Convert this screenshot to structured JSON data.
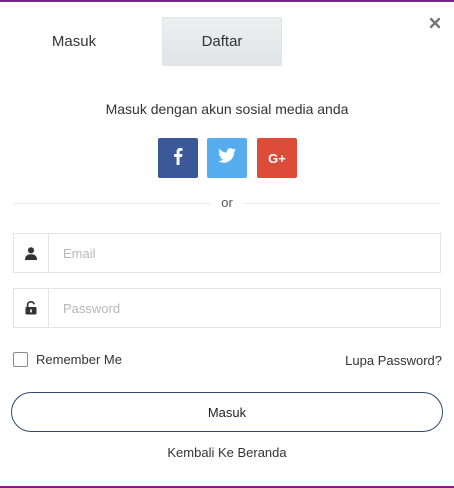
{
  "tabs": [
    {
      "label": "Masuk",
      "active": false
    },
    {
      "label": "Daftar",
      "active": true
    }
  ],
  "close_icon": "close-icon",
  "social": {
    "title": "Masuk dengan akun sosial media anda",
    "buttons": [
      {
        "name": "facebook",
        "icon": "facebook-icon",
        "color": "#3b5998"
      },
      {
        "name": "twitter",
        "icon": "twitter-icon",
        "color": "#55acee"
      },
      {
        "name": "google-plus",
        "label": "G+",
        "color": "#dd4b39"
      }
    ]
  },
  "divider_text": "or",
  "form": {
    "email": {
      "placeholder": "Email",
      "value": "",
      "icon": "user-icon"
    },
    "password": {
      "placeholder": "Password",
      "value": "",
      "icon": "lock-open-icon"
    },
    "remember_label": "Remember Me",
    "remember_checked": false,
    "forgot_label": "Lupa Password?",
    "submit_label": "Masuk"
  },
  "back_label": "Kembali Ke Beranda",
  "colors": {
    "accent_border": "#7b1f86",
    "submit_border": "#2e4a6b"
  }
}
